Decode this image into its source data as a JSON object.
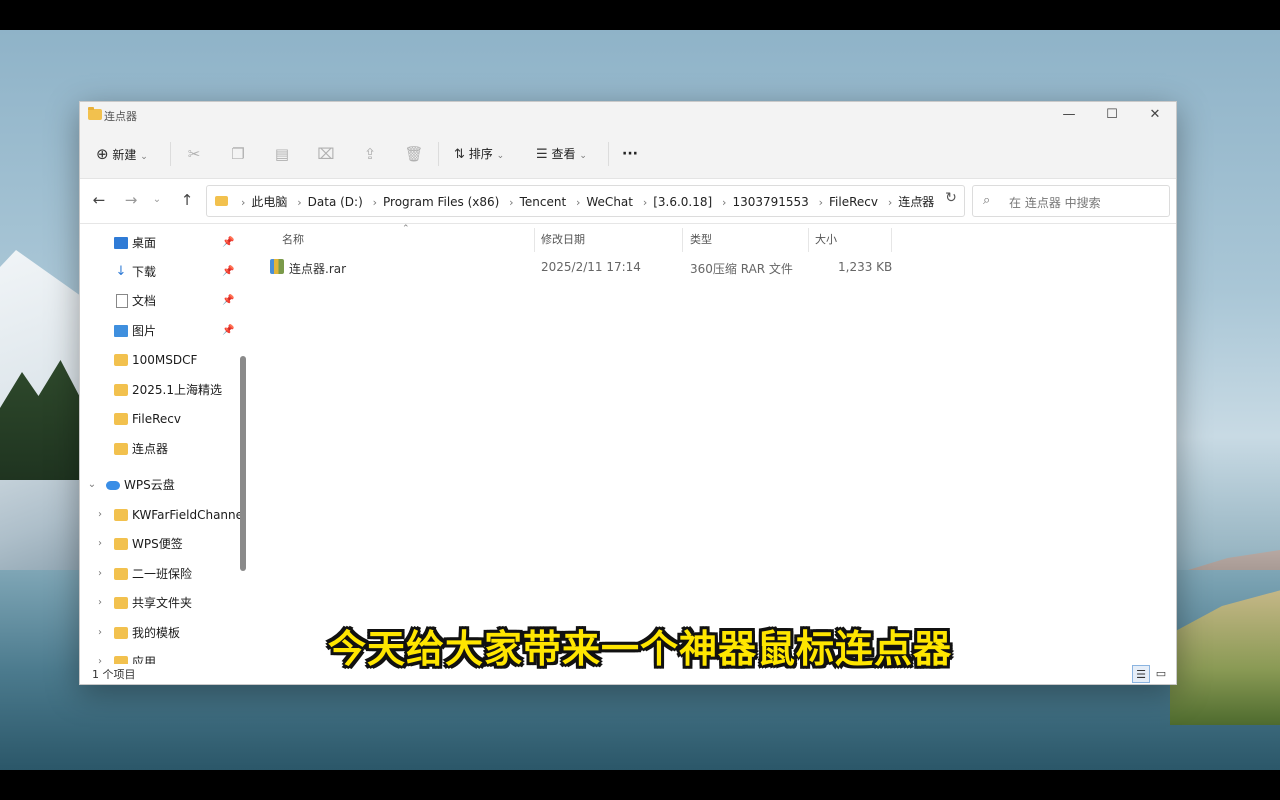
{
  "window": {
    "title": "连点器",
    "controls": {
      "minimize": "—",
      "maximize": "☐",
      "close": "✕"
    }
  },
  "toolbar": {
    "new_label": "新建",
    "sort_label": "排序",
    "view_label": "查看",
    "more_label": "···"
  },
  "address": {
    "crumbs": [
      "此电脑",
      "Data (D:)",
      "Program Files (x86)",
      "Tencent",
      "WeChat",
      "[3.6.0.18]",
      "1303791553",
      "FileRecv",
      "连点器"
    ],
    "search_placeholder": "在 连点器 中搜索"
  },
  "sidebar": {
    "quick_access": [
      {
        "label": "桌面",
        "icon": "desktop-icon",
        "pinned": true
      },
      {
        "label": "下载",
        "icon": "download-icon",
        "pinned": true
      },
      {
        "label": "文档",
        "icon": "document-icon",
        "pinned": true
      },
      {
        "label": "图片",
        "icon": "pictures-icon",
        "pinned": true
      },
      {
        "label": "100MSDCF",
        "icon": "folder-icon",
        "pinned": false
      },
      {
        "label": "2025.1上海精选",
        "icon": "folder-icon",
        "pinned": false
      },
      {
        "label": "FileRecv",
        "icon": "folder-icon",
        "pinned": false
      },
      {
        "label": "连点器",
        "icon": "folder-icon",
        "pinned": false
      }
    ],
    "cloud": {
      "label": "WPS云盘",
      "icon": "cloud-icon"
    },
    "cloud_items": [
      {
        "label": "KWFarFieldChannel"
      },
      {
        "label": "WPS便签"
      },
      {
        "label": "二一班保险"
      },
      {
        "label": "共享文件夹"
      },
      {
        "label": "我的模板"
      },
      {
        "label": "应用"
      }
    ]
  },
  "columns": {
    "name": "名称",
    "modified": "修改日期",
    "type": "类型",
    "size": "大小"
  },
  "files": [
    {
      "name": "连点器.rar",
      "modified": "2025/2/11 17:14",
      "type": "360压缩 RAR 文件",
      "size": "1,233 KB"
    }
  ],
  "status": {
    "count": "1 个项目"
  },
  "subtitle": "今天给大家带来一个神器鼠标连点器"
}
